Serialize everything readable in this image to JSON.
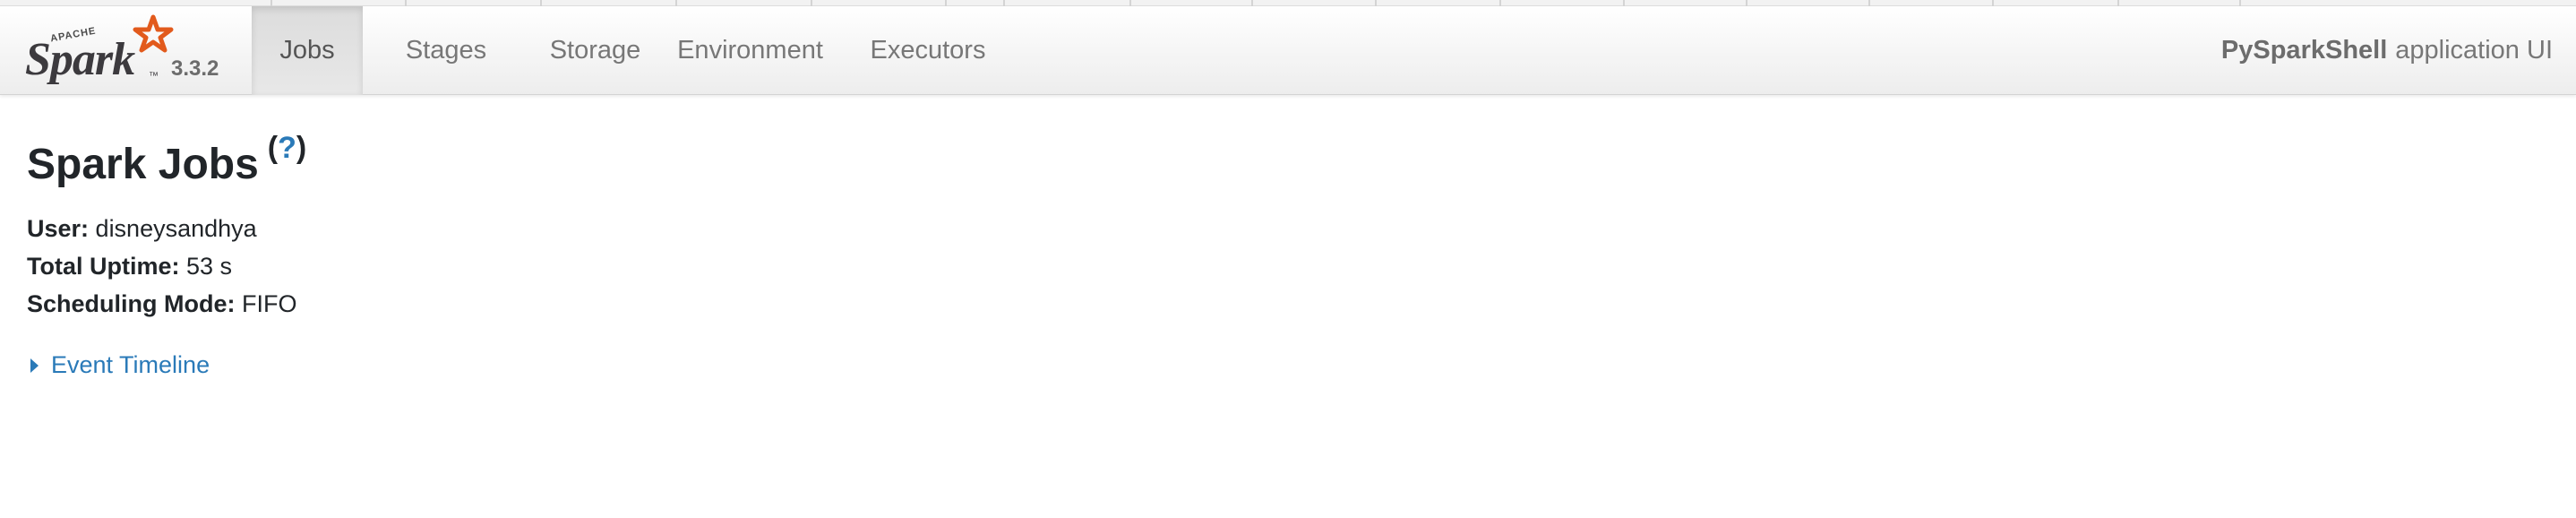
{
  "brand": {
    "apache_label": "APACHE",
    "logo_text": "Spark",
    "trademark": "™",
    "version": "3.3.2"
  },
  "nav": {
    "tabs": [
      {
        "label": "Jobs",
        "active": true
      },
      {
        "label": "Stages",
        "active": false
      },
      {
        "label": "Storage",
        "active": false
      },
      {
        "label": "Environment",
        "active": false
      },
      {
        "label": "Executors",
        "active": false
      }
    ],
    "app_name": "PySparkShell",
    "app_suffix": "application UI"
  },
  "page": {
    "title": "Spark Jobs",
    "help_open": "(",
    "help_mark": "?",
    "help_close": ")"
  },
  "summary": {
    "user_label": "User:",
    "user_value": "disneysandhya",
    "uptime_label": "Total Uptime:",
    "uptime_value": "53 s",
    "mode_label": "Scheduling Mode:",
    "mode_value": "FIFO"
  },
  "timeline": {
    "label": "Event Timeline"
  },
  "colors": {
    "link": "#2a7ab8",
    "spark_orange": "#e25a1c",
    "text": "#212529",
    "nav_text": "#777777"
  }
}
